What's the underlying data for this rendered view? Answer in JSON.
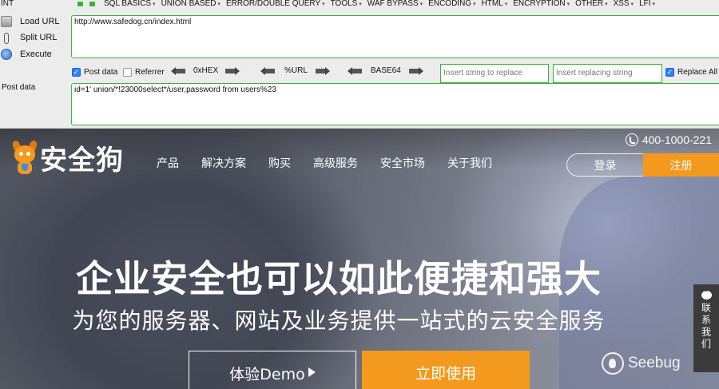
{
  "hackbar": {
    "int_label": "INT",
    "menu": [
      "SQL BASICS",
      "UNION BASED",
      "ERROR/DOUBLE QUERY",
      "TOOLS",
      "WAF BYPASS",
      "ENCODING",
      "HTML",
      "ENCRYPTION",
      "OTHER",
      "XSS",
      "LFI"
    ],
    "load_url": "Load URL",
    "split_url": "Split URL",
    "execute": "Execute",
    "url_value": "http://www.safedog.cn/index.html",
    "post_data_checkbox": "Post data",
    "post_data_checked": true,
    "referrer_checkbox": "Referrer",
    "referrer_checked": false,
    "enc_hex": "0xHEX",
    "enc_url": "%URL",
    "enc_base64": "BASE64",
    "replace_placeholder": "Insert string to replace",
    "replacing_placeholder": "Insert replacing string",
    "replace_all": "Replace All",
    "replace_all_checked": true,
    "post_label": "Post data",
    "post_value": "id=1' union/*!23000select*/user,password from users%23",
    "accent_color": "#3bb03b"
  },
  "site": {
    "logo_text": "安全狗",
    "nav": [
      "产品",
      "解决方案",
      "购买",
      "高级服务",
      "安全市场",
      "关于我们"
    ],
    "phone": "400-1000-221",
    "login": "登录",
    "register": "注册",
    "hero_title": "企业安全也可以如此便捷和强大",
    "hero_subtitle": "为您的服务器、网站及业务提供一站式的云安全服务",
    "demo_button": "体验Demo",
    "use_button": "立即使用",
    "contact": "联系我们",
    "watermark": "Seebug",
    "brand_color": "#f39a1e"
  }
}
